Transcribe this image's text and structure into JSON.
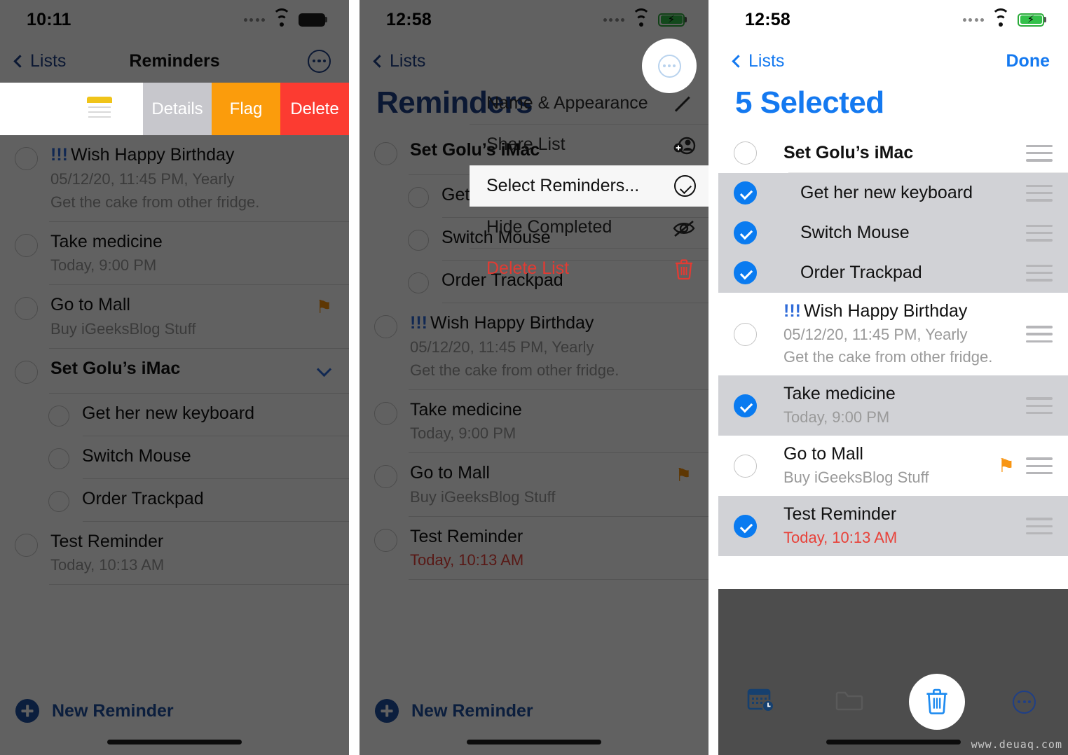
{
  "panels": [
    {
      "status": {
        "time": "10:11",
        "battery_charging": false
      },
      "nav": {
        "back_label": "Lists",
        "title": "Reminders",
        "more_icon": "ellipsis-circle-icon"
      },
      "swipe_actions": {
        "note_icon": "yellow-note-icon",
        "details": "Details",
        "flag": "Flag",
        "delete": "Delete"
      },
      "reminders": [
        {
          "title": "Wish Happy Birthday",
          "priority": "!!!",
          "sub1": "05/12/20, 11:45 PM, Yearly",
          "sub2": "Get the cake from other fridge."
        },
        {
          "title": "Take medicine",
          "sub1": "Today, 9:00 PM"
        },
        {
          "title": "Go to Mall",
          "sub1": "Buy iGeeksBlog Stuff",
          "flag": true
        },
        {
          "title": "Set Golu’s iMac",
          "bold": true,
          "chevron": "chevron-down-icon"
        },
        {
          "title": "Get her new keyboard",
          "indent": true
        },
        {
          "title": "Switch Mouse",
          "indent": true
        },
        {
          "title": "Order Trackpad",
          "indent": true
        },
        {
          "title": "Test Reminder",
          "sub1": "Today, 10:13 AM"
        }
      ],
      "new_reminder": "New Reminder"
    },
    {
      "status": {
        "time": "12:58",
        "battery_charging": true
      },
      "nav": {
        "back_label": "Lists",
        "more_icon": "ellipsis-circle-icon"
      },
      "big_title": "Reminders",
      "context_menu": [
        {
          "label": "Name & Appearance",
          "icon": "pencil-icon"
        },
        {
          "label": "Share List",
          "icon": "person-add-icon"
        },
        {
          "label": "Select Reminders...",
          "icon": "check-circle-icon",
          "highlighted": true
        },
        {
          "label": "Hide Completed",
          "icon": "eye-slash-icon"
        },
        {
          "label": "Delete List",
          "icon": "trash-icon",
          "danger": true
        }
      ],
      "reminders": [
        {
          "title": "Set Golu’s iMac",
          "bold": true
        },
        {
          "title": "Get her new keyboard",
          "indent": true
        },
        {
          "title": "Switch Mouse",
          "indent": true
        },
        {
          "title": "Order Trackpad",
          "indent": true
        },
        {
          "title": "Wish Happy Birthday",
          "priority": "!!!",
          "sub1": "05/12/20, 11:45 PM, Yearly",
          "sub2": "Get the cake from other fridge."
        },
        {
          "title": "Take medicine",
          "sub1": "Today, 9:00 PM"
        },
        {
          "title": "Go to Mall",
          "sub1": "Buy iGeeksBlog Stuff",
          "flag": true
        },
        {
          "title": "Test Reminder",
          "sub1": "Today, 10:13 AM",
          "sub1_red": true
        }
      ],
      "new_reminder": "New Reminder"
    },
    {
      "status": {
        "time": "12:58",
        "battery_charging": true
      },
      "nav": {
        "back_label": "Lists",
        "done_label": "Done"
      },
      "big_title": "5 Selected",
      "selected_count": 5,
      "rows": [
        {
          "title": "Set Golu’s iMac",
          "bold": true,
          "selected": false
        },
        {
          "title": "Get her new keyboard",
          "indent": true,
          "selected": true
        },
        {
          "title": "Switch Mouse",
          "indent": true,
          "selected": true
        },
        {
          "title": "Order Trackpad",
          "indent": true,
          "selected": true
        },
        {
          "title": "Wish Happy Birthday",
          "priority": "!!!",
          "sub1": "05/12/20, 11:45 PM, Yearly",
          "sub2": "Get the cake from other fridge.",
          "selected": false
        },
        {
          "title": "Take medicine",
          "sub1": "Today, 9:00 PM",
          "selected": true
        },
        {
          "title": "Go to Mall",
          "sub1": "Buy iGeeksBlog Stuff",
          "flag": true,
          "selected": false
        },
        {
          "title": "Test Reminder",
          "sub1": "Today, 10:13 AM",
          "sub1_red": true,
          "selected": true
        }
      ],
      "toolbar": [
        {
          "icon": "calendar-clock-icon",
          "name": "schedule-button"
        },
        {
          "icon": "folder-icon",
          "name": "move-to-list-button"
        },
        {
          "icon": "trash-icon",
          "name": "delete-button"
        },
        {
          "icon": "ellipsis-circle-icon",
          "name": "more-button"
        }
      ]
    }
  ],
  "watermark": "www.deuaq.com",
  "colors": {
    "accent_blue": "#1479f0",
    "dim_blue": "#1f3f86",
    "flag_orange": "#f89512",
    "delete_red": "#fc3b31",
    "details_gray": "#c7c7cc",
    "swipe_flag_orange": "#fb9c0c",
    "selected_row": "#d1d2d6",
    "overdue_red": "#e8423a"
  }
}
